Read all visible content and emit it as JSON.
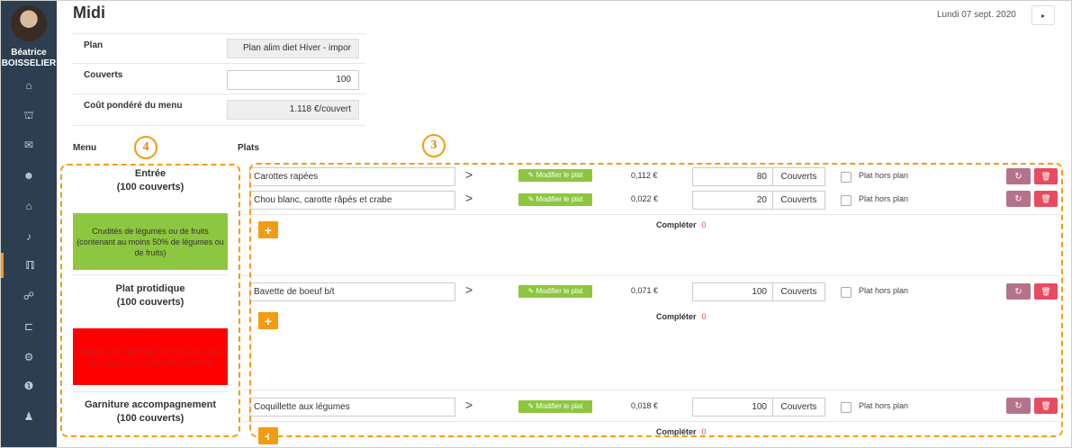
{
  "user": {
    "name_line1": "Béatrice",
    "name_line2": "BOISSELIER"
  },
  "sidebar": {
    "items": [
      {
        "icon": "home-icon",
        "glyph": "⌂"
      },
      {
        "icon": "bank-icon",
        "glyph": "⛫"
      },
      {
        "icon": "comments-icon",
        "glyph": "✉"
      },
      {
        "icon": "users-icon",
        "glyph": "☻"
      },
      {
        "icon": "house-icon",
        "glyph": "⌂"
      },
      {
        "icon": "bell-icon",
        "glyph": "♪"
      },
      {
        "icon": "cutlery-icon",
        "glyph": "ℿ"
      },
      {
        "icon": "handshake-icon",
        "glyph": "☍"
      },
      {
        "icon": "cart-icon",
        "glyph": "⊏"
      },
      {
        "icon": "cogs-icon",
        "glyph": "⚙"
      },
      {
        "icon": "info-icon",
        "glyph": "❶"
      },
      {
        "icon": "user-plus-icon",
        "glyph": "♟"
      }
    ],
    "active_index": 6
  },
  "header": {
    "title": "Midi",
    "date": "Lundi 07 sept. 2020",
    "next_glyph": "▸"
  },
  "fields": {
    "plan_label": "Plan",
    "plan_value": "Plan alim diet Hiver - impor",
    "couverts_label": "Couverts",
    "couverts_value": "100",
    "cout_label": "Coût pondéré du menu",
    "cout_value": "1.118 €/couvert"
  },
  "columns": {
    "menu": "Menu",
    "plats": "Plats"
  },
  "categories": [
    {
      "title": "Entrée",
      "subtitle": "(100 couverts)",
      "note": "Crudités de légumes ou de fruits (contenant au moins 50% de légumes ou de fruits)"
    },
    {
      "title": "Plat protidique",
      "subtitle": "(100 couverts)",
      "note": "Viandes non hachées de boeuf, de veau ou d'agneau, et abats de boucherie"
    },
    {
      "title": "Garniture accompagnement",
      "subtitle": "(100 couverts)"
    }
  ],
  "dishes": [
    {
      "name": "Carottes rapées",
      "modify": "✎ Modifier le plat",
      "price": "0,112 €",
      "qty": "80",
      "unit": "Couverts",
      "hors_plan": "Plat hors plan"
    },
    {
      "name": "Chou blanc, carotte râpés et crabe",
      "modify": "✎ Modifier le plat",
      "price": "0,022 €",
      "qty": "20",
      "unit": "Couverts",
      "hors_plan": "Plat hors plan"
    },
    {
      "name": "Bavette de boeuf b/t",
      "modify": "✎ Modifier le plat",
      "price": "0,071 €",
      "qty": "100",
      "unit": "Couverts",
      "hors_plan": "Plat hors plan"
    },
    {
      "name": "Coquillette aux légumes",
      "modify": "✎ Modifier le plat",
      "price": "0,018 €",
      "qty": "100",
      "unit": "Couverts",
      "hors_plan": "Plat hors plan"
    }
  ],
  "completer": {
    "label": "Compléter",
    "count_1": "0",
    "count_2": "0",
    "count_3": "0"
  },
  "actions": {
    "add_glyph": "+",
    "refresh_glyph": "↻",
    "trash_glyph": "🗑"
  },
  "annotations": {
    "marker_menu": "4",
    "marker_plats": "3",
    "color": "#f39c12"
  }
}
